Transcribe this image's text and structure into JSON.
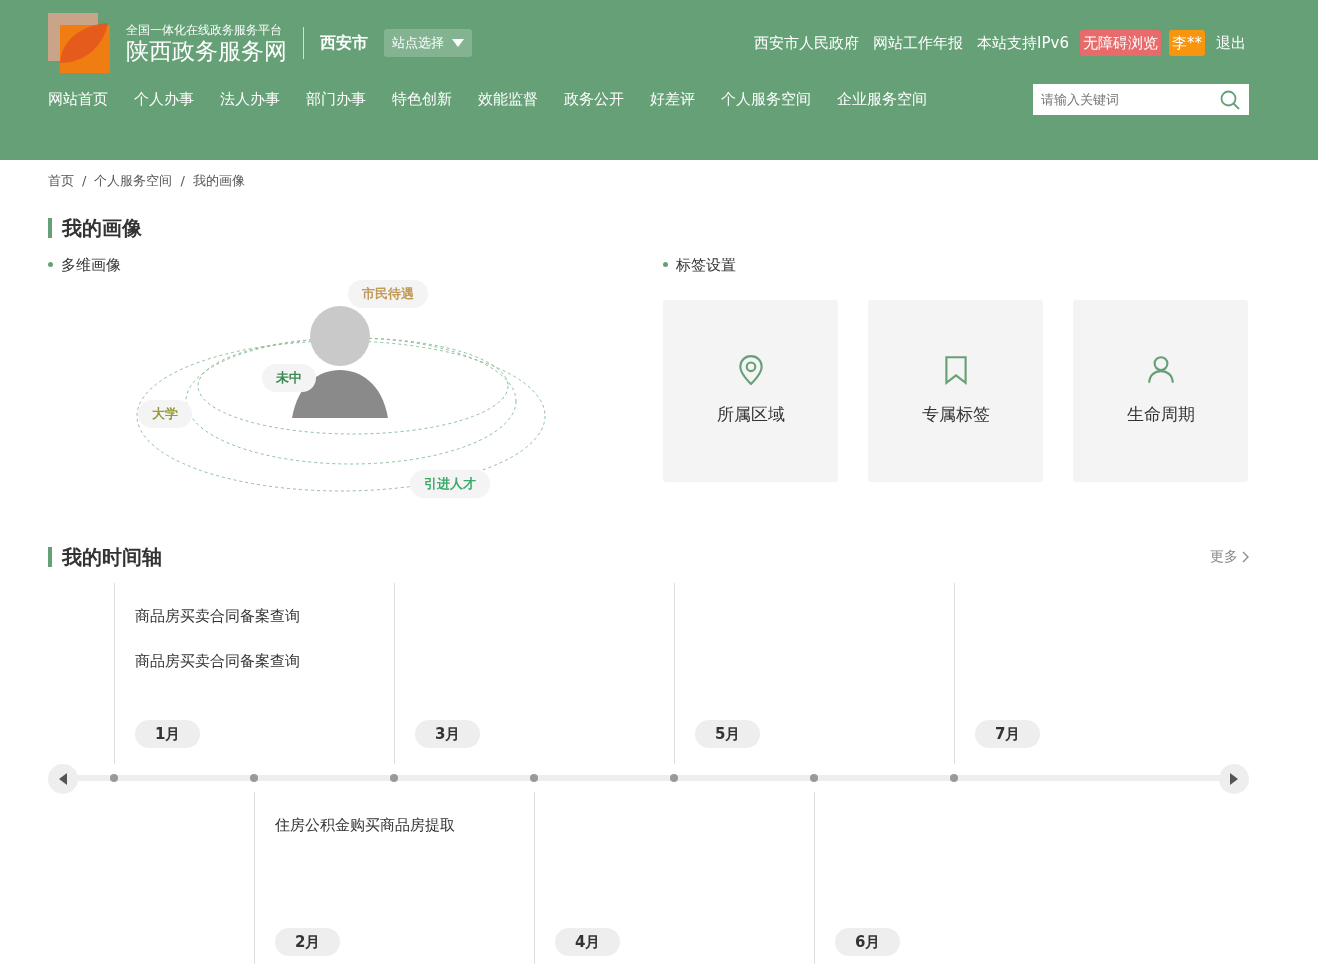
{
  "header": {
    "platform": "全国一体化在线政务服务平台",
    "site_name": "陕西政务服务网",
    "city": "西安市",
    "site_select": "站点选择",
    "links": [
      {
        "kind": "link",
        "label": "西安市人民政府"
      },
      {
        "kind": "link",
        "label": "网站工作年报"
      },
      {
        "kind": "link",
        "label": "本站支持IPv6"
      },
      {
        "kind": "accessible",
        "label": "无障碍浏览"
      },
      {
        "kind": "user",
        "label": "李**"
      },
      {
        "kind": "link",
        "label": "退出"
      }
    ],
    "nav": [
      "网站首页",
      "个人办事",
      "法人办事",
      "部门办事",
      "特色创新",
      "效能监督",
      "政务公开",
      "好差评",
      "个人服务空间",
      "企业服务空间"
    ],
    "search": {
      "placeholder": "请输入关键词"
    }
  },
  "breadcrumb": {
    "separator": "/",
    "items": [
      "首页",
      "个人服务空间",
      "我的画像"
    ]
  },
  "portrait": {
    "title": "我的画像",
    "multi_title": "多维画像",
    "tags": [
      {
        "label": "市民待遇",
        "color": "#c09a5a"
      },
      {
        "label": "未中",
        "color": "#3d8a55"
      },
      {
        "label": "大学",
        "color": "#9a9a3a"
      },
      {
        "label": "引进人才",
        "color": "#3aaa6a"
      }
    ],
    "settings_title": "标签设置",
    "settings": [
      {
        "kind": "location",
        "label": "所属区域"
      },
      {
        "kind": "bookmark",
        "label": "专属标签"
      },
      {
        "kind": "person",
        "label": "生命周期"
      }
    ]
  },
  "timeline": {
    "title": "我的时间轴",
    "more": "更多",
    "upper_months": [
      {
        "label": "1月",
        "events": [
          "商品房买卖合同备案查询",
          "商品房买卖合同备案查询"
        ]
      },
      {
        "label": "3月"
      },
      {
        "label": "5月"
      },
      {
        "label": "7月"
      }
    ],
    "lower_months": [
      {
        "label": "2月",
        "events": [
          "住房公积金购买商品房提取"
        ]
      },
      {
        "label": "4月"
      },
      {
        "label": "6月"
      }
    ]
  }
}
